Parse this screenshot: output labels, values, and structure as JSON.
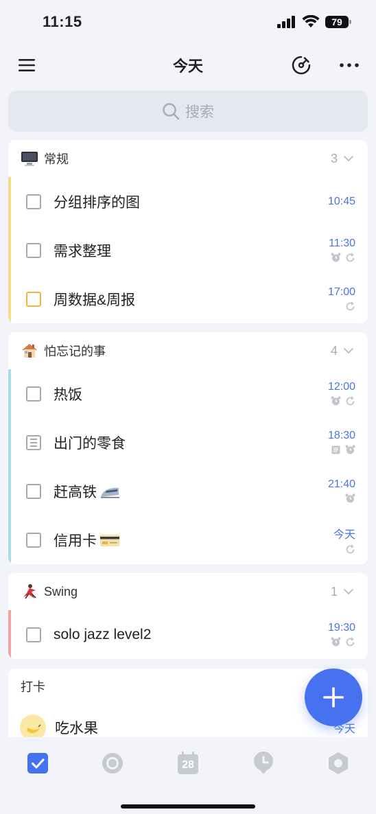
{
  "status_bar": {
    "time": "11:15",
    "battery": "79"
  },
  "header": {
    "title": "今天"
  },
  "search": {
    "placeholder": "搜索"
  },
  "groups": [
    {
      "title": "常规",
      "count": "3",
      "accent": "#f6dc8a",
      "tasks": [
        {
          "text": "分组排序的图",
          "time": "10:45"
        },
        {
          "text": "需求整理",
          "time": "11:30"
        },
        {
          "text": "周数据&周报",
          "time": "17:00"
        }
      ]
    },
    {
      "title": "怕忘记的事",
      "count": "4",
      "accent": "#a9dce9",
      "tasks": [
        {
          "text": "热饭",
          "time": "12:00"
        },
        {
          "text": "出门的零食",
          "time": "18:30"
        },
        {
          "text": "赶高铁",
          "time": "21:40"
        },
        {
          "text": "信用卡",
          "time": "今天"
        }
      ]
    },
    {
      "title": "Swing",
      "count": "1",
      "accent": "#f0a4a4",
      "tasks": [
        {
          "text": "solo jazz level2",
          "time": "19:30"
        }
      ]
    },
    {
      "title": "打卡",
      "tasks": [
        {
          "text": "吃水果",
          "time": "今天"
        }
      ]
    }
  ],
  "colors": {
    "accent_blue": "#4772ef",
    "time_blue": "#4a74e8"
  },
  "tabbar": {
    "calendar_day": "28"
  }
}
